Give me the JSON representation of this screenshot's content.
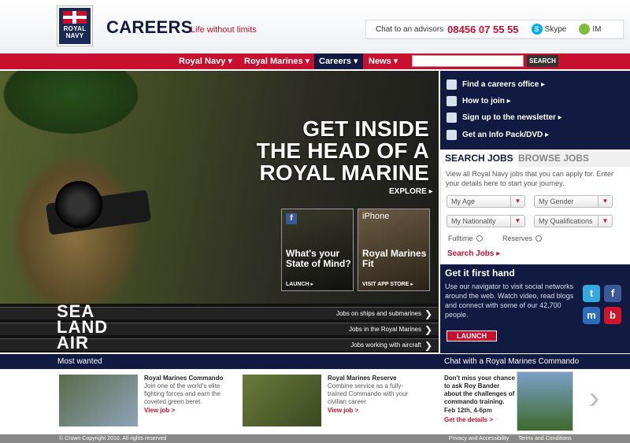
{
  "header": {
    "logo_line1": "ROYAL",
    "logo_line2": "NAVY",
    "title": "CAREERS",
    "tagline": "Life without limits",
    "chat_label": "Chat to an advisors",
    "phone": "08456 07 55 55",
    "skype_label": "Skype",
    "im_label": "IM"
  },
  "nav": {
    "items": [
      "Royal Navy",
      "Royal Marines",
      "Careers",
      "News"
    ],
    "active": "Careers",
    "search_button": "SEARCH",
    "search_value": ""
  },
  "hero": {
    "headline_1": "GET INSIDE",
    "headline_2": "THE HEAD OF A",
    "headline_3": "ROYAL MARINE",
    "explore": "EXPLORE ▸",
    "promo1_title": "What's your State of Mind?",
    "promo1_cta": "LAUNCH ▸",
    "promo2_badge": "iPhone",
    "promo2_title": "Royal Marines Fit",
    "promo2_cta": "VISIT APP STORE ▸"
  },
  "stripe": {
    "word1": "SEA",
    "word2": "LAND",
    "word3": "AIR",
    "link1": "Jobs on ships and submarines",
    "link2": "Jobs in the Royal Marines",
    "link3": "Jobs working with aircraft"
  },
  "quicklinks": [
    "Find a careers office ▸",
    "How to join ▸",
    "Sign up to the newsletter ▸",
    "Get an Info Pack/DVD ▸"
  ],
  "jobs": {
    "tab_search": "SEARCH JOBS",
    "tab_browse": "BROWSE JOBS",
    "description": "View all Royal Navy jobs that you can apply for. Enter your details here to start your journey.",
    "dropdowns": [
      "My Age",
      "My Gender",
      "My Nationality",
      "My Qualifications"
    ],
    "radio1": "Fulltime",
    "radio2": "Reserves",
    "search_link": "Search Jobs ▸"
  },
  "social": {
    "title": "Get it first hand",
    "text": "Use our navigator to visit social networks around the web. Watch video, read blogs and connect with some of our 42,700 people.",
    "launch": "LAUNCH"
  },
  "bottom": {
    "most_wanted": "Most wanted",
    "chat_heading": "Chat with a Royal Marines Commando",
    "feature1_title": "Royal Marines Commando",
    "feature1_desc": "Join one of the world's elite fighting forces and earn the coveted green beret.",
    "feature1_link": "View job >",
    "feature2_title": "Royal Marines Reserve",
    "feature2_desc": "Combine service as a fully-trained Commando with your civilian career",
    "feature2_link": "View job >",
    "chat_text": "Don't miss your chance to ask Roy Bander about the challenges of commando training.",
    "chat_date": "Feb 12th, 4-6pm",
    "chat_link": "Get the details >"
  },
  "footer": {
    "copyright": "© Crown Copyright 2010. All rights reserved",
    "privacy": "Privacy and Accessibility",
    "terms": "Terms and Conditions"
  },
  "colors": {
    "brand_red": "#c8102e",
    "navy": "#111a40"
  }
}
